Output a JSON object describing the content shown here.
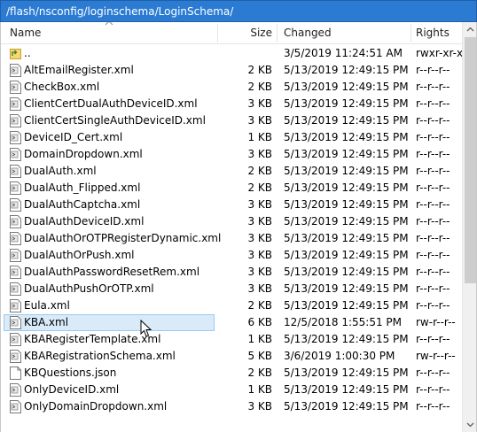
{
  "path": "/flash/nsconfig/loginschema/LoginSchema/",
  "columns": {
    "name": "Name",
    "size": "Size",
    "changed": "Changed",
    "rights": "Rights"
  },
  "rows": [
    {
      "name": "..",
      "size": "",
      "changed": "3/5/2019 11:24:51 AM",
      "rights": "rwxr-xr-x",
      "icon": "parent-folder-icon"
    },
    {
      "name": "AltEmailRegister.xml",
      "size": "2 KB",
      "changed": "5/13/2019 12:49:15 PM",
      "rights": "r--r--r--",
      "icon": "xml-file-icon"
    },
    {
      "name": "CheckBox.xml",
      "size": "2 KB",
      "changed": "5/13/2019 12:49:15 PM",
      "rights": "r--r--r--",
      "icon": "xml-file-icon"
    },
    {
      "name": "ClientCertDualAuthDeviceID.xml",
      "size": "3 KB",
      "changed": "5/13/2019 12:49:15 PM",
      "rights": "r--r--r--",
      "icon": "xml-file-icon"
    },
    {
      "name": "ClientCertSingleAuthDeviceID.xml",
      "size": "3 KB",
      "changed": "5/13/2019 12:49:15 PM",
      "rights": "r--r--r--",
      "icon": "xml-file-icon"
    },
    {
      "name": "DeviceID_Cert.xml",
      "size": "1 KB",
      "changed": "5/13/2019 12:49:15 PM",
      "rights": "r--r--r--",
      "icon": "xml-file-icon"
    },
    {
      "name": "DomainDropdown.xml",
      "size": "3 KB",
      "changed": "5/13/2019 12:49:15 PM",
      "rights": "r--r--r--",
      "icon": "xml-file-icon"
    },
    {
      "name": "DualAuth.xml",
      "size": "2 KB",
      "changed": "5/13/2019 12:49:15 PM",
      "rights": "r--r--r--",
      "icon": "xml-file-icon"
    },
    {
      "name": "DualAuth_Flipped.xml",
      "size": "2 KB",
      "changed": "5/13/2019 12:49:15 PM",
      "rights": "r--r--r--",
      "icon": "xml-file-icon"
    },
    {
      "name": "DualAuthCaptcha.xml",
      "size": "3 KB",
      "changed": "5/13/2019 12:49:15 PM",
      "rights": "r--r--r--",
      "icon": "xml-file-icon"
    },
    {
      "name": "DualAuthDeviceID.xml",
      "size": "3 KB",
      "changed": "5/13/2019 12:49:15 PM",
      "rights": "r--r--r--",
      "icon": "xml-file-icon"
    },
    {
      "name": "DualAuthOrOTPRegisterDynamic.xml",
      "size": "3 KB",
      "changed": "5/13/2019 12:49:15 PM",
      "rights": "r--r--r--",
      "icon": "xml-file-icon"
    },
    {
      "name": "DualAuthOrPush.xml",
      "size": "3 KB",
      "changed": "5/13/2019 12:49:15 PM",
      "rights": "r--r--r--",
      "icon": "xml-file-icon"
    },
    {
      "name": "DualAuthPasswordResetRem.xml",
      "size": "3 KB",
      "changed": "5/13/2019 12:49:15 PM",
      "rights": "r--r--r--",
      "icon": "xml-file-icon"
    },
    {
      "name": "DualAuthPushOrOTP.xml",
      "size": "3 KB",
      "changed": "5/13/2019 12:49:15 PM",
      "rights": "r--r--r--",
      "icon": "xml-file-icon"
    },
    {
      "name": "Eula.xml",
      "size": "2 KB",
      "changed": "5/13/2019 12:49:15 PM",
      "rights": "r--r--r--",
      "icon": "xml-file-icon"
    },
    {
      "name": "KBA.xml",
      "size": "6 KB",
      "changed": "12/5/2018 1:55:51 PM",
      "rights": "rw-r--r--",
      "icon": "xml-file-icon",
      "selected": true
    },
    {
      "name": "KBARegisterTemplate.xml",
      "size": "1 KB",
      "changed": "5/13/2019 12:49:15 PM",
      "rights": "r--r--r--",
      "icon": "xml-file-icon"
    },
    {
      "name": "KBARegistrationSchema.xml",
      "size": "5 KB",
      "changed": "3/6/2019 1:00:30 PM",
      "rights": "rw-r--r--",
      "icon": "xml-file-icon"
    },
    {
      "name": "KBQuestions.json",
      "size": "2 KB",
      "changed": "5/13/2019 12:49:15 PM",
      "rights": "r--r--r--",
      "icon": "blank-file-icon"
    },
    {
      "name": "OnlyDeviceID.xml",
      "size": "1 KB",
      "changed": "5/13/2019 12:49:15 PM",
      "rights": "r--r--r--",
      "icon": "xml-file-icon"
    },
    {
      "name": "OnlyDomainDropdown.xml",
      "size": "3 KB",
      "changed": "5/13/2019 12:49:15 PM",
      "rights": "r--r--r--",
      "icon": "xml-file-icon"
    }
  ],
  "colors": {
    "pathbar": "#2b7bd3",
    "selection_fill": "#d9ebf9",
    "selection_border": "#99cbf5"
  }
}
